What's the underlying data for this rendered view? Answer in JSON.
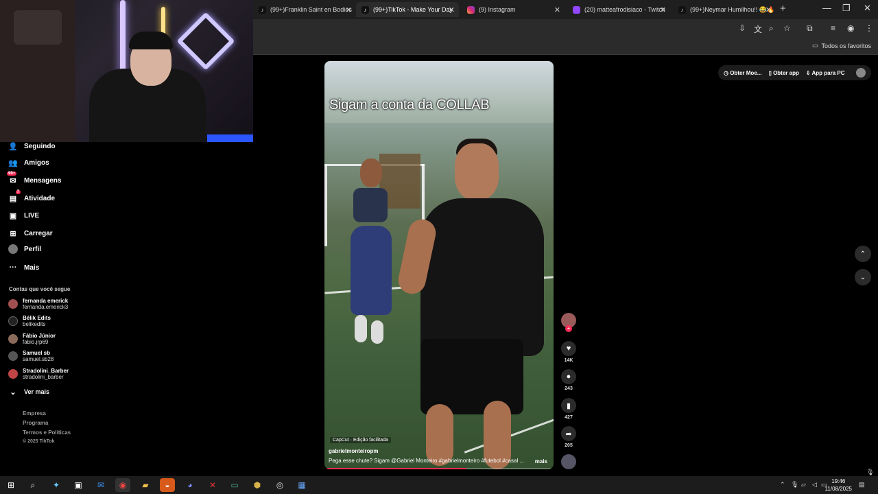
{
  "browser": {
    "tabs": [
      {
        "title": "(99+)Franklin Saint en Bodies",
        "favicon": "tiktok-icon",
        "active": false
      },
      {
        "title": "(99+)TikTok - Make Your Day",
        "favicon": "tiktok-icon",
        "active": true
      },
      {
        "title": "(9) Instagram",
        "favicon": "instagram-icon",
        "active": false
      },
      {
        "title": "(20) matteafrodisiaco - Twitch",
        "favicon": "twitch-icon",
        "active": false
      },
      {
        "title": "(99+)Neymar Humilhou!! 😂🔥",
        "favicon": "tiktok-icon",
        "active": false
      }
    ],
    "bookmarks_label": "Todos os favoritos"
  },
  "sidebar": {
    "nav": [
      {
        "label": "Seguindo",
        "icon": "following-icon"
      },
      {
        "label": "Amigos",
        "icon": "friends-icon"
      },
      {
        "label": "Mensagens",
        "icon": "messages-icon",
        "badge": "99+"
      },
      {
        "label": "Atividade",
        "icon": "activity-icon",
        "badge": "7"
      },
      {
        "label": "LIVE",
        "icon": "live-icon"
      },
      {
        "label": "Carregar",
        "icon": "upload-icon"
      },
      {
        "label": "Perfil",
        "icon": "profile-icon"
      },
      {
        "label": "Mais",
        "icon": "more-icon"
      }
    ],
    "following_title": "Contas que você segue",
    "following": [
      {
        "name": "fernanda emerick",
        "username": "fernanda.emerick3"
      },
      {
        "name": "Bélik Edits",
        "username": "belikedits"
      },
      {
        "name": "Fábio Júnior",
        "username": "fabio.jrp69"
      },
      {
        "name": "Samuel sb",
        "username": "samuel.sb28"
      },
      {
        "name": "Stradolini_Barber",
        "username": "stradolini_barber"
      }
    ],
    "see_more": "Ver mais",
    "footer": [
      "Empresa",
      "Programa",
      "Termos e Políticas",
      "© 2025 TikTok"
    ]
  },
  "top_actions": {
    "get_coins": "Obter Moe...",
    "get_app": "Obter app",
    "pc_app": "App para PC"
  },
  "video": {
    "overlay_text": "Sigam a conta da COLLAB",
    "capcut_label": "CapCut · Edição facilitada",
    "author": "gabrielmonteiropm",
    "description": "Pega esse chute? Sigam @Gabriel Monteiro  #gabrielmonteiro #futebol #casal ...",
    "more_label": "mais",
    "progress": 0.62
  },
  "actions": {
    "likes": "14K",
    "comments": "243",
    "saves": "427",
    "shares": "205"
  },
  "taskbar": {
    "time": "19:46",
    "date": "11/08/2025"
  },
  "colors": {
    "accent": "#fe2c55",
    "background": "#000000",
    "sidebar_muted": "#999999"
  }
}
